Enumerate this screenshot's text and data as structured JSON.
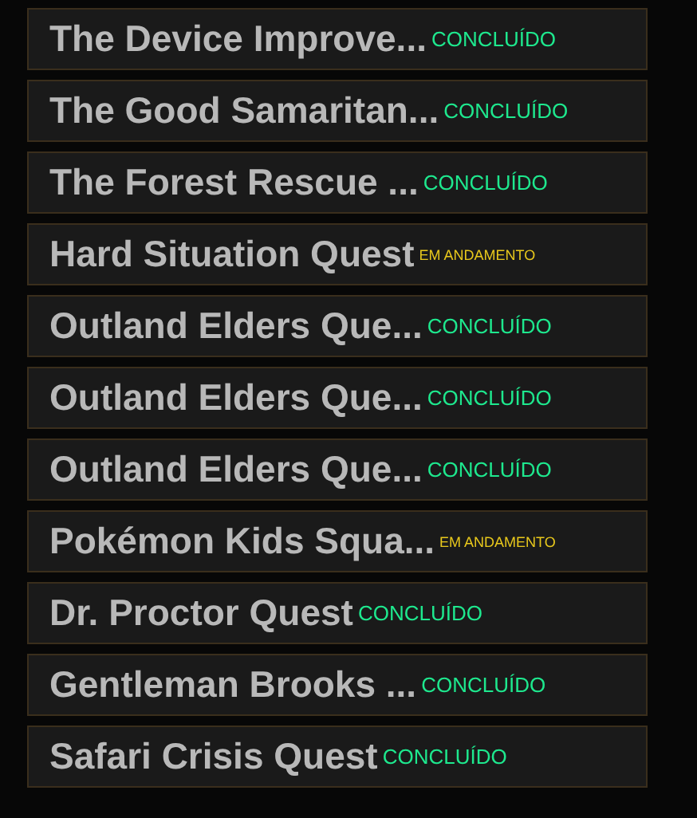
{
  "quests": [
    {
      "title": "The Device Improve...",
      "status": "CONCLUÍDO",
      "kind": "done"
    },
    {
      "title": "The Good Samaritan...",
      "status": "CONCLUÍDO",
      "kind": "done"
    },
    {
      "title": "The Forest Rescue ...",
      "status": "CONCLUÍDO",
      "kind": "done"
    },
    {
      "title": "Hard Situation Quest",
      "status": "EM ANDAMENTO",
      "kind": "progress"
    },
    {
      "title": "Outland Elders Que...",
      "status": "CONCLUÍDO",
      "kind": "done"
    },
    {
      "title": "Outland Elders Que...",
      "status": "CONCLUÍDO",
      "kind": "done"
    },
    {
      "title": "Outland Elders Que...",
      "status": "CONCLUÍDO",
      "kind": "done"
    },
    {
      "title": "Pokémon Kids Squa...",
      "status": "EM ANDAMENTO",
      "kind": "progress"
    },
    {
      "title": "Dr. Proctor Quest",
      "status": "CONCLUÍDO",
      "kind": "done"
    },
    {
      "title": "Gentleman Brooks ...",
      "status": "CONCLUÍDO",
      "kind": "done"
    },
    {
      "title": "Safari Crisis Quest",
      "status": "CONCLUÍDO",
      "kind": "done"
    }
  ]
}
